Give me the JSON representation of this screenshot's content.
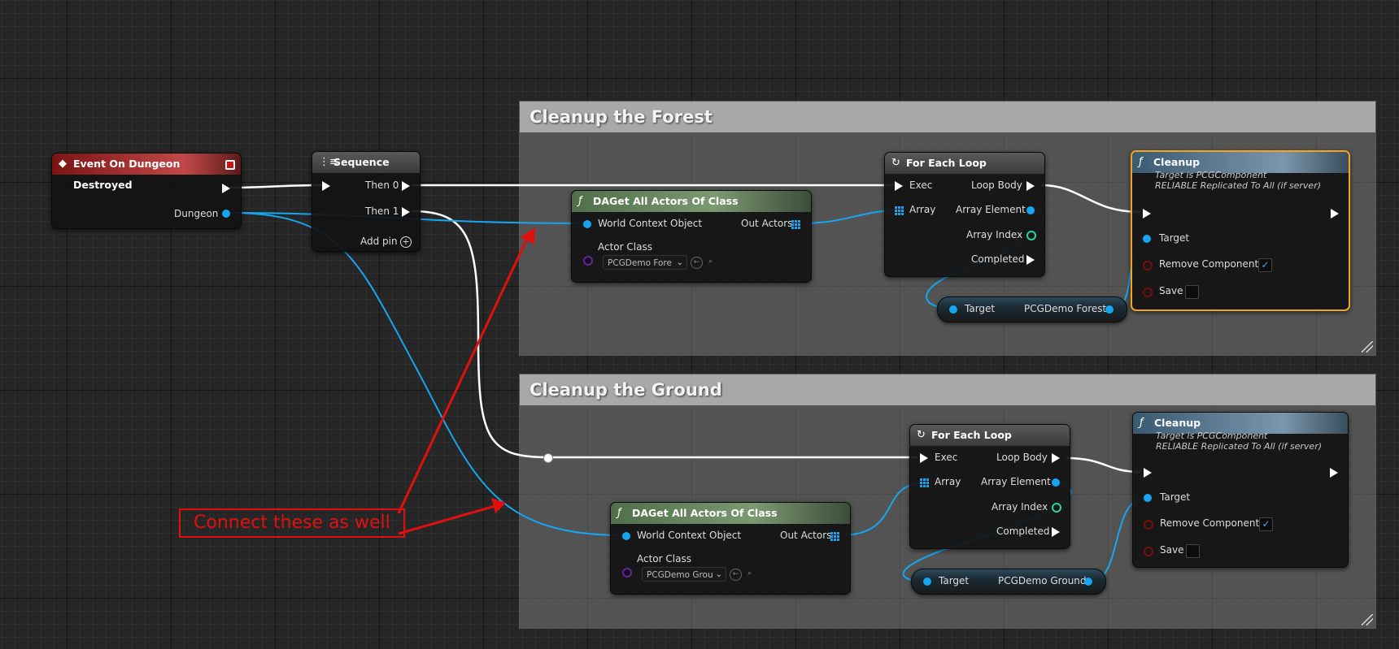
{
  "comments": {
    "forest_title": "Cleanup the Forest",
    "ground_title": "Cleanup the Ground"
  },
  "event_node": {
    "title": "Event On Dungeon Destroyed",
    "out_dungeon": "Dungeon"
  },
  "sequence_node": {
    "title": "Sequence",
    "then0": "Then 0",
    "then1": "Then 1",
    "add_pin": "Add pin"
  },
  "forest": {
    "get_actors": {
      "title": "DAGet All Actors Of Class",
      "world_context": "World Context Object",
      "out_actors": "Out Actors",
      "actor_class": "Actor Class",
      "class_value": "PCGDemo Fore"
    },
    "for_each": {
      "title": "For Each Loop",
      "exec": "Exec",
      "array": "Array",
      "loop_body": "Loop Body",
      "array_element": "Array Element",
      "array_index": "Array Index",
      "completed": "Completed"
    },
    "cleanup": {
      "title": "Cleanup",
      "sub1": "Target is PCGComponent",
      "sub2": "RELIABLE Replicated To All (if server)",
      "target": "Target",
      "remove_components": "Remove Components",
      "save": "Save"
    },
    "var_node": {
      "target": "Target",
      "value": "PCGDemo Forest"
    }
  },
  "ground": {
    "get_actors": {
      "title": "DAGet All Actors Of Class",
      "world_context": "World Context Object",
      "out_actors": "Out Actors",
      "actor_class": "Actor Class",
      "class_value": "PCGDemo Grou"
    },
    "for_each": {
      "title": "For Each Loop",
      "exec": "Exec",
      "array": "Array",
      "loop_body": "Loop Body",
      "array_element": "Array Element",
      "array_index": "Array Index",
      "completed": "Completed"
    },
    "cleanup": {
      "title": "Cleanup",
      "sub1": "Target is PCGComponent",
      "sub2": "RELIABLE Replicated To All (if server)",
      "target": "Target",
      "remove_components": "Remove Components",
      "save": "Save"
    },
    "var_node": {
      "target": "Target",
      "value": "PCGDemo Ground"
    }
  },
  "annotation": {
    "text": "Connect these as well",
    "color": "#e01010"
  },
  "colors": {
    "exec_wire": "#ffffff",
    "object_wire": "#16a6f0",
    "accent_selected": "#f4a520"
  },
  "icons": {
    "event": "event-diamond-icon",
    "sequence": "sequence-icon",
    "function": "function-f-icon",
    "loop": "loop-icon"
  }
}
